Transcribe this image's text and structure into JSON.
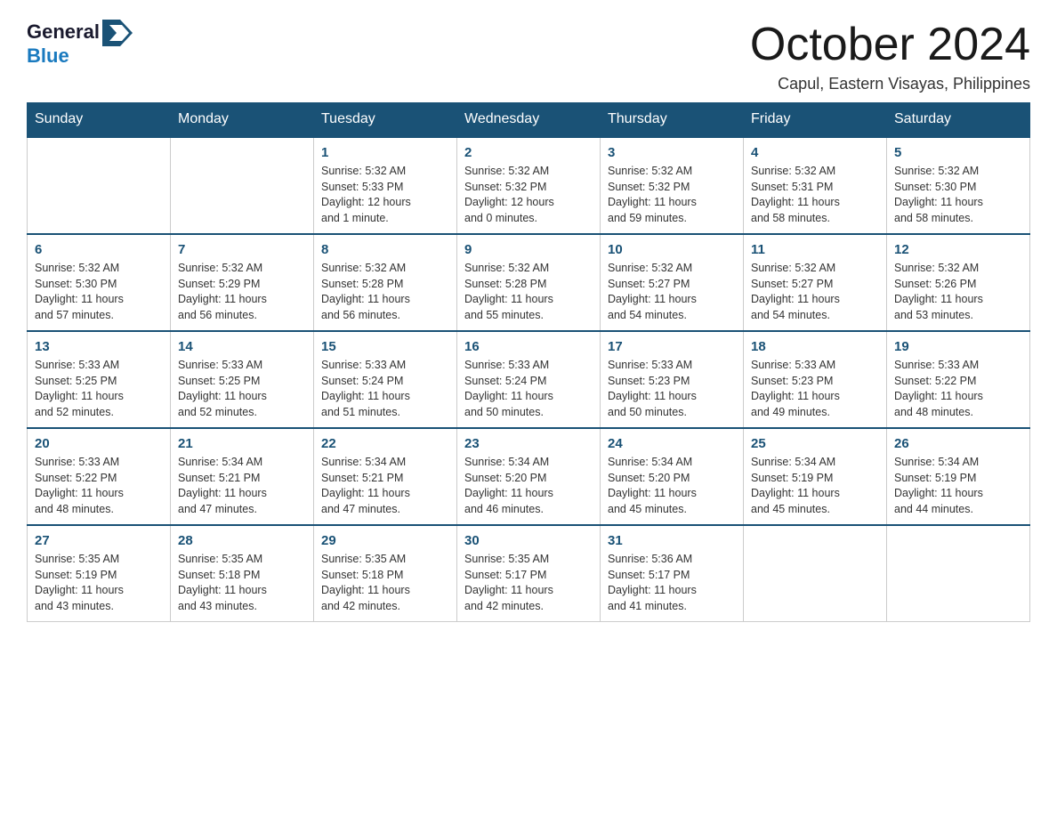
{
  "header": {
    "logo_general": "General",
    "logo_blue": "Blue",
    "month_title": "October 2024",
    "location": "Capul, Eastern Visayas, Philippines"
  },
  "days_of_week": [
    "Sunday",
    "Monday",
    "Tuesday",
    "Wednesday",
    "Thursday",
    "Friday",
    "Saturday"
  ],
  "weeks": [
    [
      {
        "day": "",
        "info": ""
      },
      {
        "day": "",
        "info": ""
      },
      {
        "day": "1",
        "info": "Sunrise: 5:32 AM\nSunset: 5:33 PM\nDaylight: 12 hours\nand 1 minute."
      },
      {
        "day": "2",
        "info": "Sunrise: 5:32 AM\nSunset: 5:32 PM\nDaylight: 12 hours\nand 0 minutes."
      },
      {
        "day": "3",
        "info": "Sunrise: 5:32 AM\nSunset: 5:32 PM\nDaylight: 11 hours\nand 59 minutes."
      },
      {
        "day": "4",
        "info": "Sunrise: 5:32 AM\nSunset: 5:31 PM\nDaylight: 11 hours\nand 58 minutes."
      },
      {
        "day": "5",
        "info": "Sunrise: 5:32 AM\nSunset: 5:30 PM\nDaylight: 11 hours\nand 58 minutes."
      }
    ],
    [
      {
        "day": "6",
        "info": "Sunrise: 5:32 AM\nSunset: 5:30 PM\nDaylight: 11 hours\nand 57 minutes."
      },
      {
        "day": "7",
        "info": "Sunrise: 5:32 AM\nSunset: 5:29 PM\nDaylight: 11 hours\nand 56 minutes."
      },
      {
        "day": "8",
        "info": "Sunrise: 5:32 AM\nSunset: 5:28 PM\nDaylight: 11 hours\nand 56 minutes."
      },
      {
        "day": "9",
        "info": "Sunrise: 5:32 AM\nSunset: 5:28 PM\nDaylight: 11 hours\nand 55 minutes."
      },
      {
        "day": "10",
        "info": "Sunrise: 5:32 AM\nSunset: 5:27 PM\nDaylight: 11 hours\nand 54 minutes."
      },
      {
        "day": "11",
        "info": "Sunrise: 5:32 AM\nSunset: 5:27 PM\nDaylight: 11 hours\nand 54 minutes."
      },
      {
        "day": "12",
        "info": "Sunrise: 5:32 AM\nSunset: 5:26 PM\nDaylight: 11 hours\nand 53 minutes."
      }
    ],
    [
      {
        "day": "13",
        "info": "Sunrise: 5:33 AM\nSunset: 5:25 PM\nDaylight: 11 hours\nand 52 minutes."
      },
      {
        "day": "14",
        "info": "Sunrise: 5:33 AM\nSunset: 5:25 PM\nDaylight: 11 hours\nand 52 minutes."
      },
      {
        "day": "15",
        "info": "Sunrise: 5:33 AM\nSunset: 5:24 PM\nDaylight: 11 hours\nand 51 minutes."
      },
      {
        "day": "16",
        "info": "Sunrise: 5:33 AM\nSunset: 5:24 PM\nDaylight: 11 hours\nand 50 minutes."
      },
      {
        "day": "17",
        "info": "Sunrise: 5:33 AM\nSunset: 5:23 PM\nDaylight: 11 hours\nand 50 minutes."
      },
      {
        "day": "18",
        "info": "Sunrise: 5:33 AM\nSunset: 5:23 PM\nDaylight: 11 hours\nand 49 minutes."
      },
      {
        "day": "19",
        "info": "Sunrise: 5:33 AM\nSunset: 5:22 PM\nDaylight: 11 hours\nand 48 minutes."
      }
    ],
    [
      {
        "day": "20",
        "info": "Sunrise: 5:33 AM\nSunset: 5:22 PM\nDaylight: 11 hours\nand 48 minutes."
      },
      {
        "day": "21",
        "info": "Sunrise: 5:34 AM\nSunset: 5:21 PM\nDaylight: 11 hours\nand 47 minutes."
      },
      {
        "day": "22",
        "info": "Sunrise: 5:34 AM\nSunset: 5:21 PM\nDaylight: 11 hours\nand 47 minutes."
      },
      {
        "day": "23",
        "info": "Sunrise: 5:34 AM\nSunset: 5:20 PM\nDaylight: 11 hours\nand 46 minutes."
      },
      {
        "day": "24",
        "info": "Sunrise: 5:34 AM\nSunset: 5:20 PM\nDaylight: 11 hours\nand 45 minutes."
      },
      {
        "day": "25",
        "info": "Sunrise: 5:34 AM\nSunset: 5:19 PM\nDaylight: 11 hours\nand 45 minutes."
      },
      {
        "day": "26",
        "info": "Sunrise: 5:34 AM\nSunset: 5:19 PM\nDaylight: 11 hours\nand 44 minutes."
      }
    ],
    [
      {
        "day": "27",
        "info": "Sunrise: 5:35 AM\nSunset: 5:19 PM\nDaylight: 11 hours\nand 43 minutes."
      },
      {
        "day": "28",
        "info": "Sunrise: 5:35 AM\nSunset: 5:18 PM\nDaylight: 11 hours\nand 43 minutes."
      },
      {
        "day": "29",
        "info": "Sunrise: 5:35 AM\nSunset: 5:18 PM\nDaylight: 11 hours\nand 42 minutes."
      },
      {
        "day": "30",
        "info": "Sunrise: 5:35 AM\nSunset: 5:17 PM\nDaylight: 11 hours\nand 42 minutes."
      },
      {
        "day": "31",
        "info": "Sunrise: 5:36 AM\nSunset: 5:17 PM\nDaylight: 11 hours\nand 41 minutes."
      },
      {
        "day": "",
        "info": ""
      },
      {
        "day": "",
        "info": ""
      }
    ]
  ]
}
